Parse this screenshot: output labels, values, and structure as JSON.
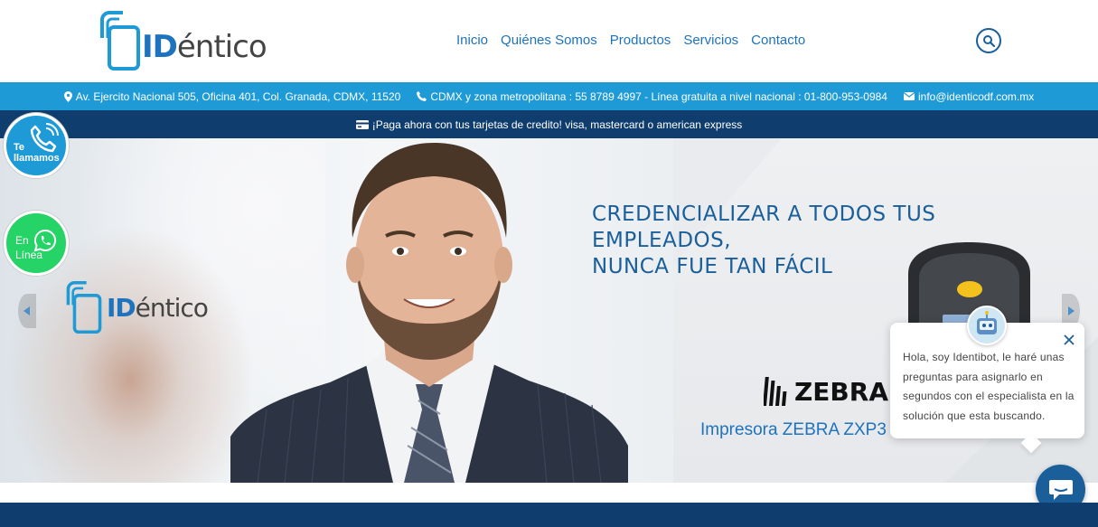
{
  "header": {
    "logo": {
      "id_part": "ID",
      "rest_part": "éntico"
    },
    "nav": [
      "Inicio",
      "Quiénes Somos",
      "Productos",
      "Servicios",
      "Contacto"
    ],
    "search_icon": "search-icon"
  },
  "infobar": {
    "address": "Av. Ejercito Nacional 505, Oficina 401, Col. Granada, CDMX, 11520",
    "phone": "CDMX y zona metropolitana : 55 8789 4997 - Línea gratuita a nivel nacional : 01-800-953-0984",
    "email": "info@identicodf.com.mx"
  },
  "paybar": {
    "text": "¡Paga ahora con tus tarjetas de credito! visa, mastercard o american express"
  },
  "floating": {
    "call": {
      "line1": "Te",
      "line2": "llamamos"
    },
    "whatsapp": {
      "line1": "En",
      "line2": "Línea"
    }
  },
  "hero": {
    "logo": {
      "id_part": "ID",
      "rest_part": "éntico"
    },
    "headline_line1": "CREDENCIALIZAR A TODOS TUS EMPLEADOS,",
    "headline_line2": "NUNCA FUE TAN FÁCIL",
    "brand": "ZEBRA",
    "caption": "Impresora ZEBRA ZXP3"
  },
  "chat": {
    "message": "Hola, soy Identibot, le haré unas preguntas para asignarlo en segundos con el especialista en la solución que esta buscando."
  },
  "colors": {
    "primary": "#1e73be",
    "infobar": "#1e9bd7",
    "navy": "#0f3d6e",
    "whatsapp": "#25d366"
  }
}
